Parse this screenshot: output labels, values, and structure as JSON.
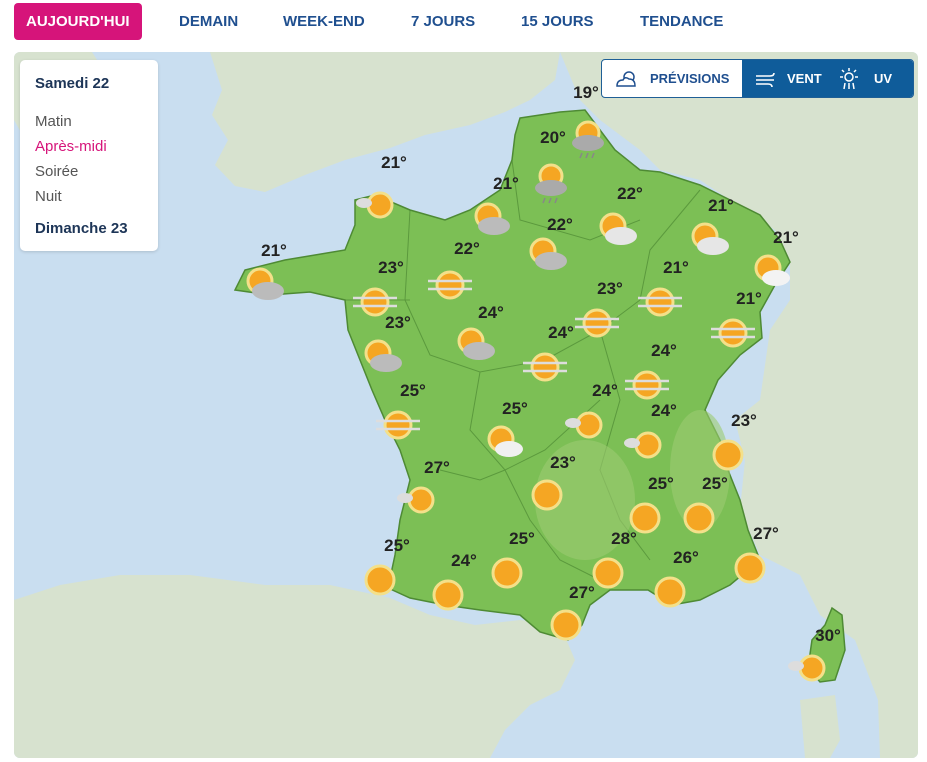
{
  "tabs": [
    {
      "label": "AUJOURD'HUI",
      "active": true
    },
    {
      "label": "DEMAIN",
      "active": false
    },
    {
      "label": "WEEK-END",
      "active": false
    },
    {
      "label": "7 JOURS",
      "active": false
    },
    {
      "label": "15 JOURS",
      "active": false
    },
    {
      "label": "TENDANCE",
      "active": false
    }
  ],
  "panel": {
    "day1": "Samedi 22",
    "periods": [
      {
        "label": "Matin",
        "active": false
      },
      {
        "label": "Après-midi",
        "active": true
      },
      {
        "label": "Soirée",
        "active": false
      },
      {
        "label": "Nuit",
        "active": false
      }
    ],
    "day2": "Dimanche 23"
  },
  "toggle": {
    "previsions": "PRÉVISIONS",
    "vent": "VENT",
    "uv": "UV",
    "active": "vent"
  },
  "colors": {
    "accent": "#d6147a",
    "nav": "#1f4f8f",
    "toggle_active": "#0f5c9a",
    "land": "#7cbf55",
    "sea": "#c9def0",
    "sun": "#f5a623"
  },
  "cities": [
    {
      "temp": "19°",
      "icon": "sun-cloud-rain"
    },
    {
      "temp": "20°",
      "icon": "sun-cloud-rain"
    },
    {
      "temp": "21°",
      "icon": "sun-small-cloud"
    },
    {
      "temp": "21°",
      "icon": "sun-cloud"
    },
    {
      "temp": "22°",
      "icon": "sun-cloud"
    },
    {
      "temp": "22°",
      "icon": "sun-cloud"
    },
    {
      "temp": "21°",
      "icon": "sun-cloud"
    },
    {
      "temp": "21°",
      "icon": "sun-cloud"
    },
    {
      "temp": "21°",
      "icon": "sun-cloud"
    },
    {
      "temp": "22°",
      "icon": "sun-fog"
    },
    {
      "temp": "23°",
      "icon": "sun-fog"
    },
    {
      "temp": "23°",
      "icon": "sun-fog"
    },
    {
      "temp": "21°",
      "icon": "sun-fog"
    },
    {
      "temp": "21°",
      "icon": "sun-fog"
    },
    {
      "temp": "24°",
      "icon": "sun-cloud"
    },
    {
      "temp": "23°",
      "icon": "sun-cloud"
    },
    {
      "temp": "24°",
      "icon": "sun-fog"
    },
    {
      "temp": "24°",
      "icon": "sun-fog"
    },
    {
      "temp": "25°",
      "icon": "sun-fog"
    },
    {
      "temp": "25°",
      "icon": "sun-cloud"
    },
    {
      "temp": "24°",
      "icon": "sun-small-cloud"
    },
    {
      "temp": "24°",
      "icon": "sun-small-cloud"
    },
    {
      "temp": "23°",
      "icon": "sun"
    },
    {
      "temp": "27°",
      "icon": "sun-small-cloud"
    },
    {
      "temp": "23°",
      "icon": "sun"
    },
    {
      "temp": "25°",
      "icon": "sun"
    },
    {
      "temp": "25°",
      "icon": "sun"
    },
    {
      "temp": "25°",
      "icon": "sun"
    },
    {
      "temp": "24°",
      "icon": "sun"
    },
    {
      "temp": "25°",
      "icon": "sun"
    },
    {
      "temp": "28°",
      "icon": "sun"
    },
    {
      "temp": "26°",
      "icon": "sun"
    },
    {
      "temp": "27°",
      "icon": "sun"
    },
    {
      "temp": "27°",
      "icon": "sun"
    },
    {
      "temp": "30°",
      "icon": "sun-small-cloud"
    }
  ]
}
